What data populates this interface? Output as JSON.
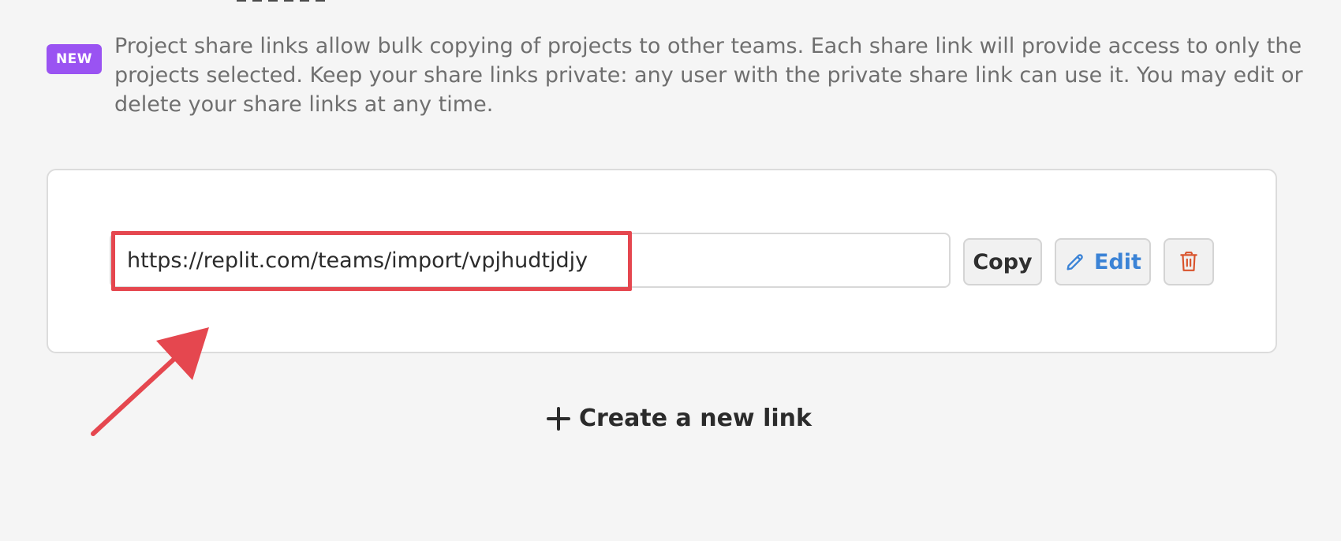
{
  "notice": {
    "badge": "NEW",
    "text": "Project share links allow bulk copying of projects to other teams. Each share link will provide access to only the projects selected. Keep your share links private: any user with the private share link can use it. You may edit or delete your share links at any time."
  },
  "share_link": {
    "value": "https://replit.com/teams/import/vpjhudtjdjy",
    "copy_label": "Copy",
    "edit_label": "Edit",
    "delete_icon": "trash-icon"
  },
  "actions": {
    "create_label": "Create a new link",
    "create_icon": "plus-icon"
  },
  "colors": {
    "badge": "#9a53f2",
    "edit": "#3b83d6",
    "delete": "#d9532b",
    "annotation": "#e5474f"
  }
}
